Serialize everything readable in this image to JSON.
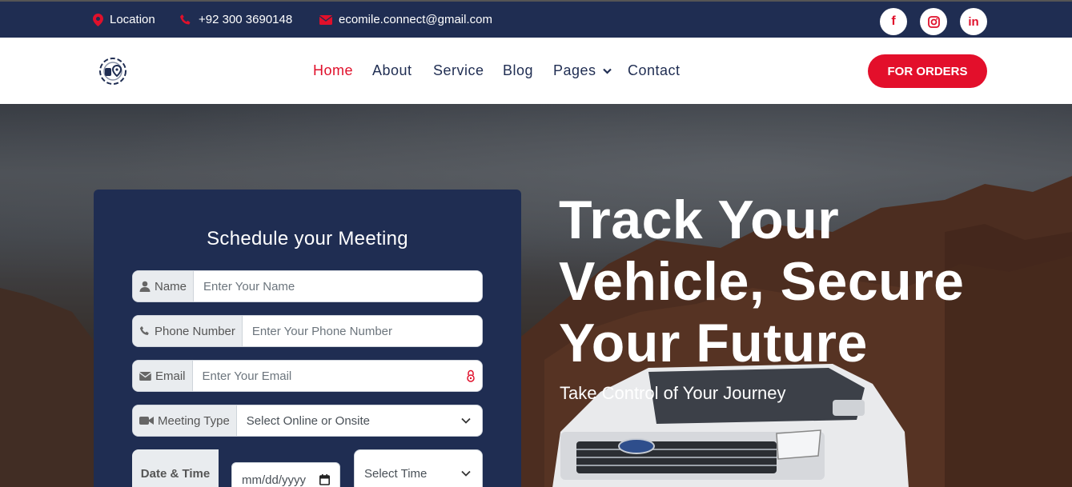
{
  "topbar": {
    "location": "Location",
    "phone": "+92 300 3690148",
    "email": "ecomile.connect@gmail.com",
    "social": [
      {
        "icon": "facebook-icon",
        "glyph": "f"
      },
      {
        "icon": "instagram-icon",
        "glyph": ""
      },
      {
        "icon": "linkedin-icon",
        "glyph": "in"
      }
    ]
  },
  "nav": {
    "items": [
      "Home",
      "About",
      "Service",
      "Blog",
      "Pages",
      "Contact"
    ],
    "active": "Home",
    "cta": "FOR ORDERS"
  },
  "form": {
    "title": "Schedule your Meeting",
    "name_label": "Name",
    "name_placeholder": "Enter Your Name",
    "phone_label": "Phone Number",
    "phone_placeholder": "Enter Your Phone Number",
    "email_label": "Email",
    "email_placeholder": "Enter Your Email",
    "meeting_label": "Meeting Type",
    "meeting_value": "Select Online or Onsite",
    "datetime_label": "Date & Time",
    "date_placeholder": "mm/dd/yyyy",
    "time_value": "Select Time"
  },
  "hero": {
    "headline": [
      "Track Your",
      "Vehicle, Secure",
      "Your Future"
    ],
    "subheadline": "Take Control of Your Journey"
  },
  "colors": {
    "navy": "#1f2d52",
    "accent_red": "#e30f2b"
  }
}
